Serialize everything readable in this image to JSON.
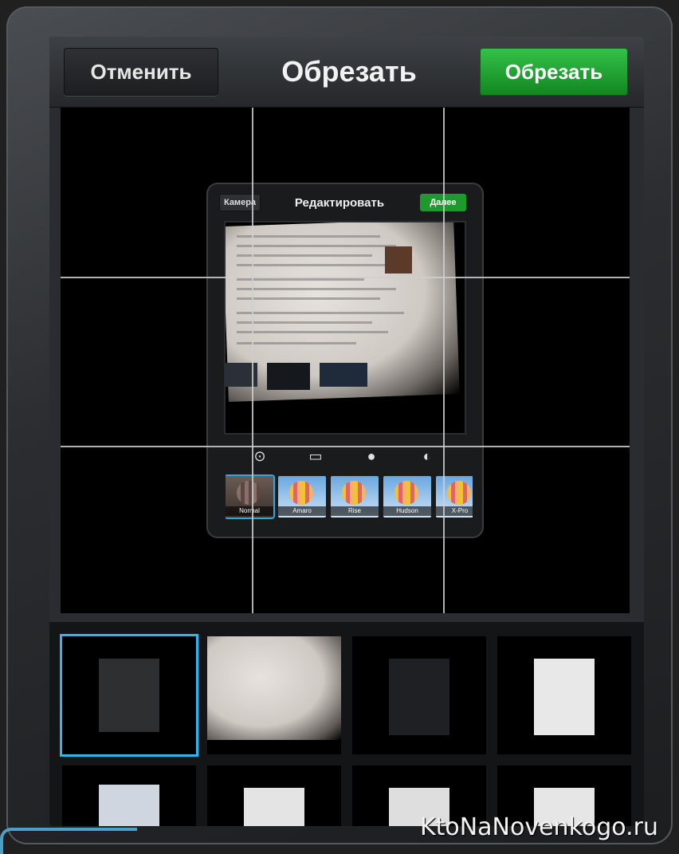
{
  "topbar": {
    "cancel_label": "Отменить",
    "title": "Обрезать",
    "crop_label": "Обрезать"
  },
  "inner_preview": {
    "back_label": "Камера",
    "title": "Редактировать",
    "done_label": "Далее",
    "tools": [
      "rotate-icon",
      "border-icon",
      "blur-icon",
      "lux-icon"
    ],
    "filters": [
      {
        "label": "Normal",
        "selected": true
      },
      {
        "label": "Amaro",
        "selected": false
      },
      {
        "label": "Rise",
        "selected": false
      },
      {
        "label": "Hudson",
        "selected": false
      },
      {
        "label": "X-Pro",
        "selected": false
      }
    ]
  },
  "gallery": {
    "selected_index": 0,
    "count": 8
  },
  "watermark": "KtoNaNovenkogo.ru",
  "colors": {
    "accent_green": "#1e9a2c",
    "selection_blue": "#2eb6ef"
  }
}
